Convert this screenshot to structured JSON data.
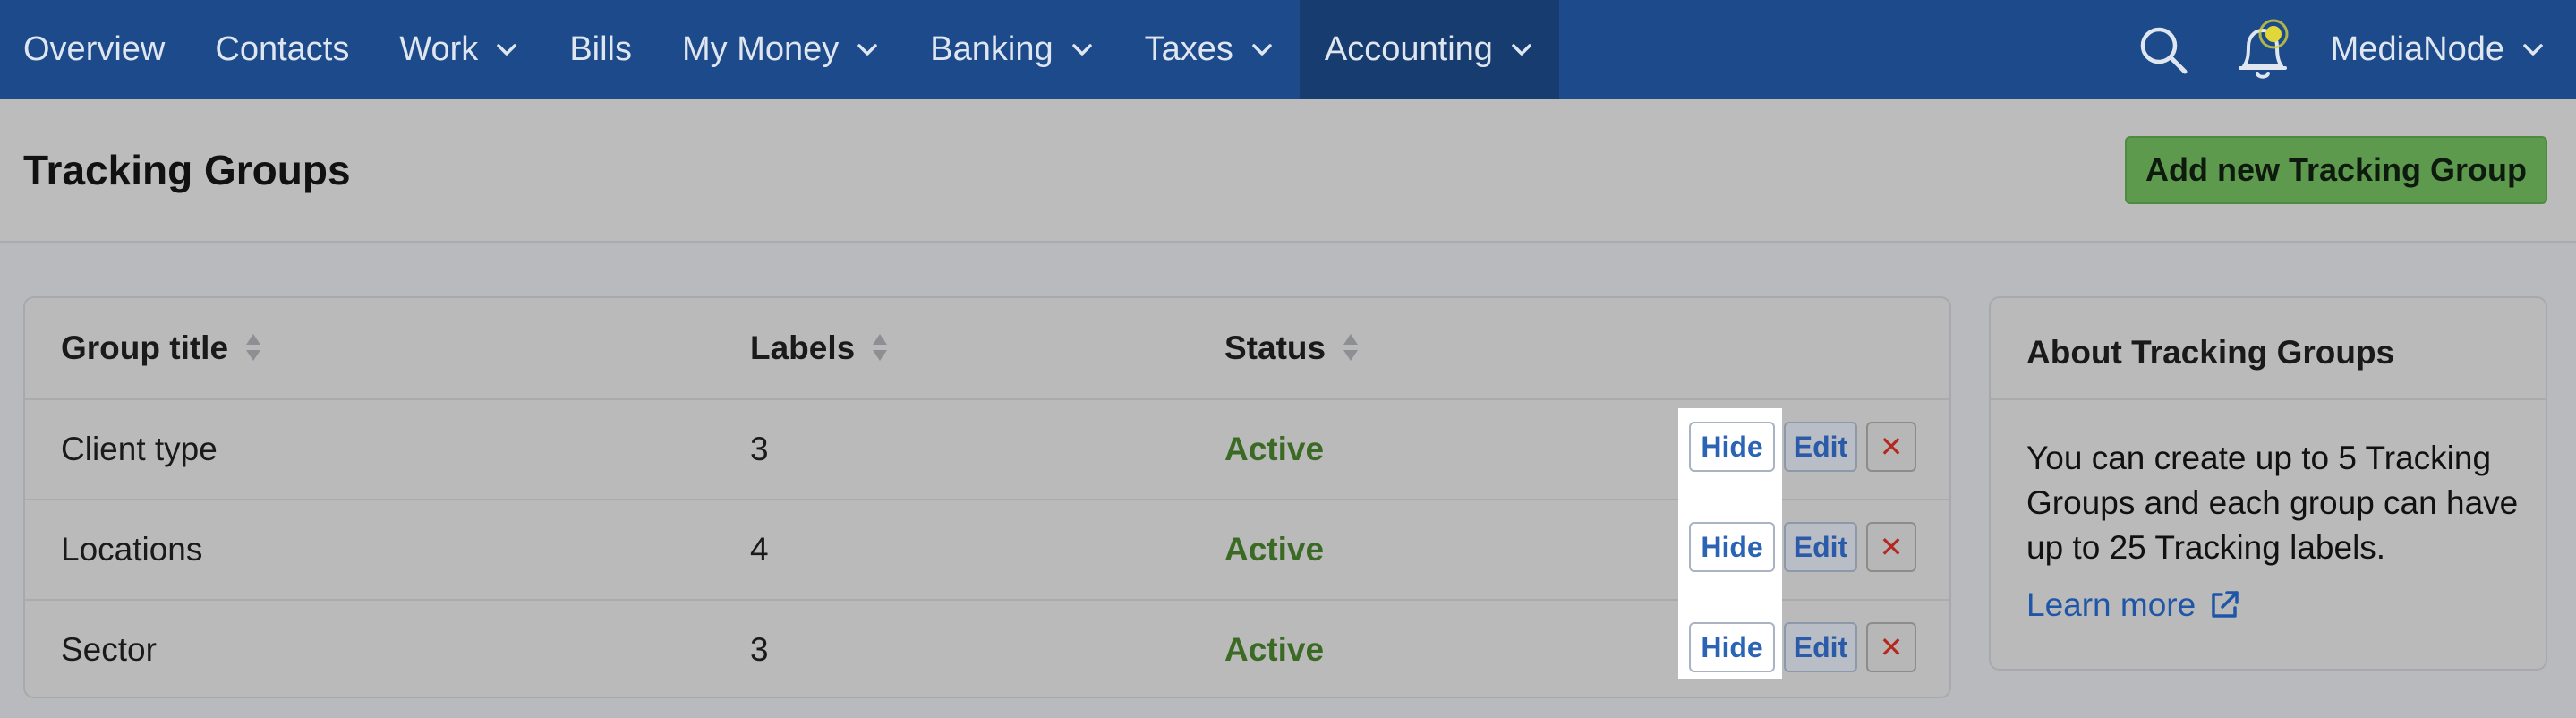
{
  "nav": {
    "items": [
      {
        "label": "Overview",
        "dropdown": false
      },
      {
        "label": "Contacts",
        "dropdown": false
      },
      {
        "label": "Work",
        "dropdown": true
      },
      {
        "label": "Bills",
        "dropdown": false
      },
      {
        "label": "My Money",
        "dropdown": true
      },
      {
        "label": "Banking",
        "dropdown": true
      },
      {
        "label": "Taxes",
        "dropdown": true
      },
      {
        "label": "Accounting",
        "dropdown": true,
        "active": true
      }
    ],
    "user_label": "MediaNode",
    "search_icon": "search-icon",
    "notification_icon": "bell-icon"
  },
  "header": {
    "title": "Tracking Groups",
    "add_button": "Add new Tracking Group"
  },
  "table": {
    "columns": [
      "Group title",
      "Labels",
      "Status"
    ],
    "rows": [
      {
        "title": "Client type",
        "labels": "3",
        "status": "Active"
      },
      {
        "title": "Locations",
        "labels": "4",
        "status": "Active"
      },
      {
        "title": "Sector",
        "labels": "3",
        "status": "Active"
      }
    ],
    "actions": {
      "hide": "Hide",
      "edit": "Edit",
      "delete": "✕"
    }
  },
  "sidebar": {
    "title": "About Tracking Groups",
    "text": "You can create up to 5 Tracking Groups and each group can have up to 25 Tracking labels.",
    "link": "Learn more"
  },
  "colors": {
    "nav_bg": "#1c4a8a",
    "nav_active": "#173c6f",
    "add_button": "#5e9a4e",
    "active_status": "#3a6a23",
    "link": "#1f56a8"
  }
}
